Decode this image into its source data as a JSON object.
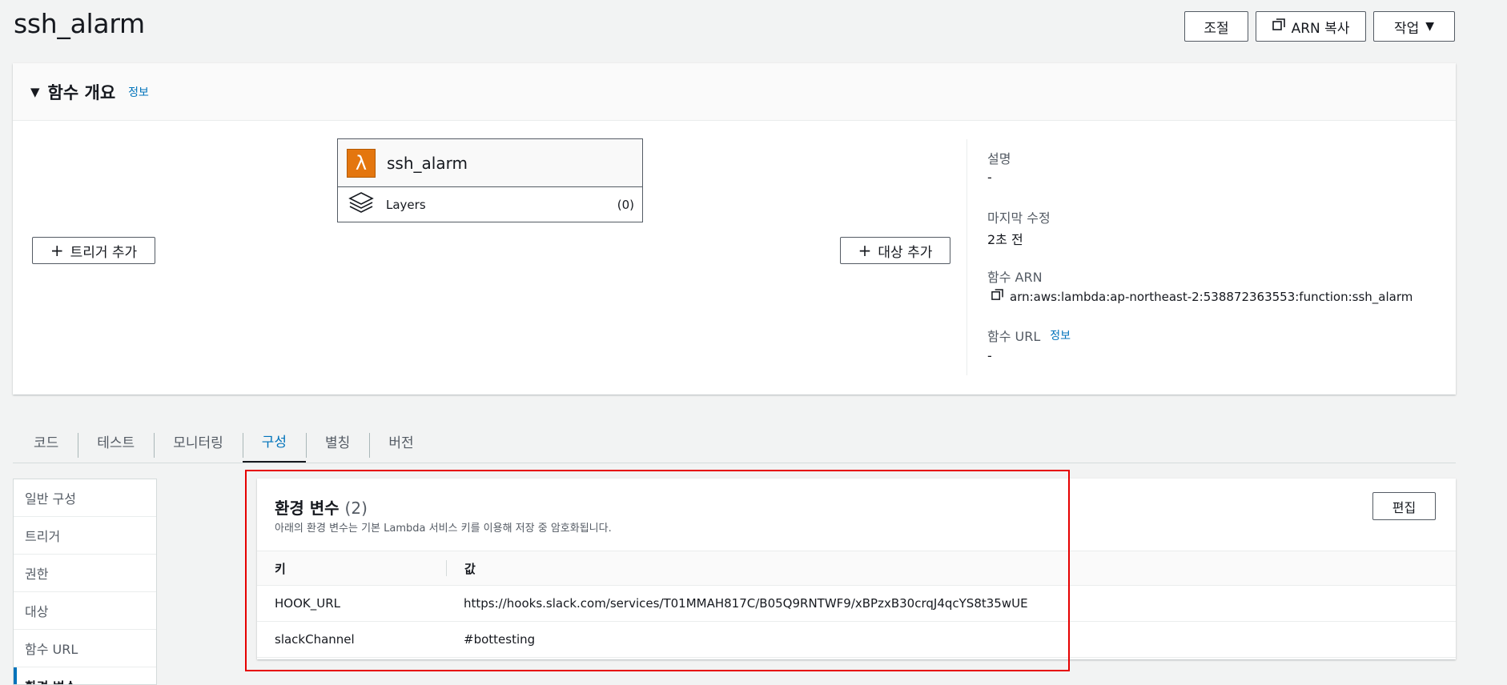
{
  "header": {
    "title": "ssh_alarm",
    "throttle_label": "조절",
    "copy_arn_label": "ARN 복사",
    "actions_label": "작업"
  },
  "overview": {
    "title": "함수 개요",
    "info_label": "정보",
    "function_name": "ssh_alarm",
    "layers_label": "Layers",
    "layers_count": "(0)",
    "add_trigger_label": "트리거 추가",
    "add_destination_label": "대상 추가",
    "description_label": "설명",
    "description_value": "-",
    "last_modified_label": "마지막 수정",
    "last_modified_value": "2초 전",
    "arn_label": "함수 ARN",
    "arn_value": "arn:aws:lambda:ap-northeast-2:538872363553:function:ssh_alarm",
    "url_label": "함수 URL",
    "url_info_label": "정보",
    "url_value": "-"
  },
  "tabs": [
    {
      "label": "코드"
    },
    {
      "label": "테스트"
    },
    {
      "label": "모니터링"
    },
    {
      "label": "구성"
    },
    {
      "label": "별칭"
    },
    {
      "label": "버전"
    }
  ],
  "active_tab": "구성",
  "sidenav": [
    {
      "label": "일반 구성"
    },
    {
      "label": "트리거"
    },
    {
      "label": "권한"
    },
    {
      "label": "대상"
    },
    {
      "label": "함수 URL"
    },
    {
      "label": "환경 변수"
    }
  ],
  "env": {
    "title": "환경 변수",
    "count": "(2)",
    "description": "아래의 환경 변수는 기본 Lambda 서비스 키를 이용해 저장 중 암호화됩니다.",
    "edit_label": "편집",
    "col_key": "키",
    "col_value": "값",
    "rows": [
      {
        "key": "HOOK_URL",
        "value": "https://hooks.slack.com/services/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"
      },
      {
        "key": "slackChannel",
        "value": "#bottesting"
      }
    ]
  },
  "colors": {
    "link": "#0073bb",
    "lambda_orange": "#e4760e",
    "highlight": "#e60000"
  }
}
